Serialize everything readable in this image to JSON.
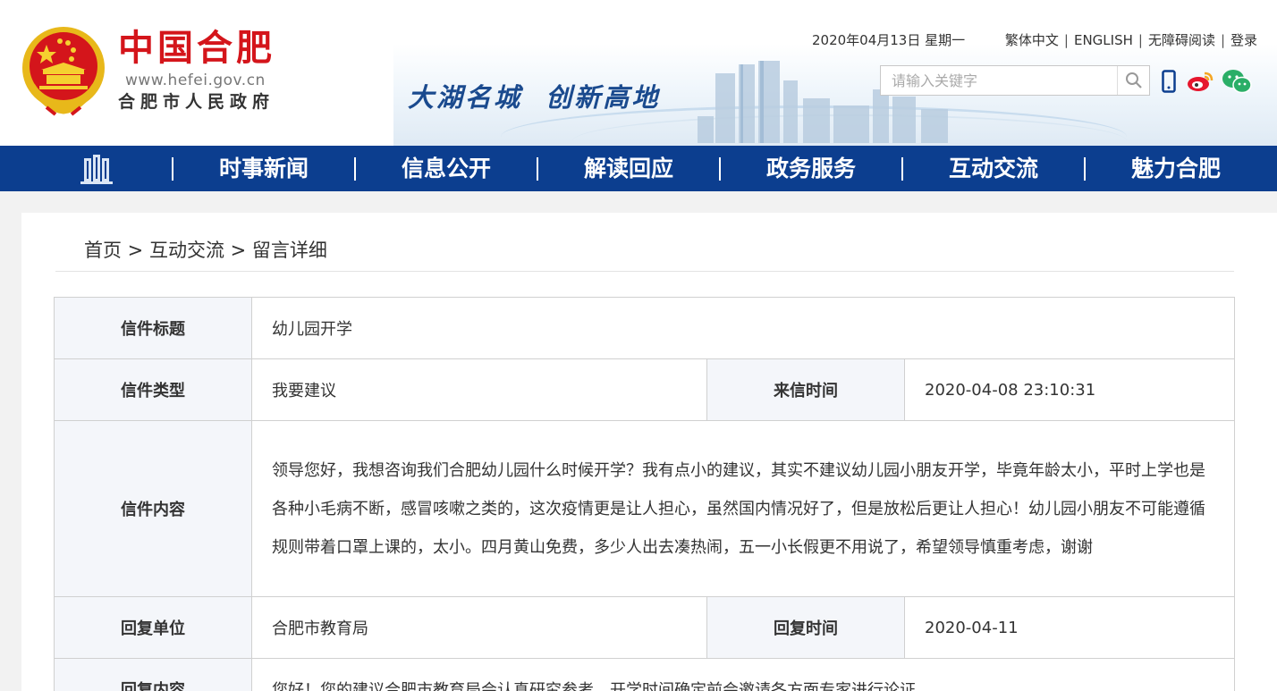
{
  "header": {
    "logo_title": "中国合肥",
    "logo_url": "www.hefei.gov.cn",
    "logo_sub": "合肥市人民政府",
    "slogan": "大湖名城  创新高地",
    "date": "2020年04月13日 星期一",
    "links": [
      "繁体中文",
      "ENGLISH",
      "无障碍阅读",
      "登录"
    ],
    "search_placeholder": "请输入关键字",
    "icons": [
      "mobile-icon",
      "weibo-icon",
      "wechat-icon"
    ]
  },
  "nav": {
    "items": [
      "时事新闻",
      "信息公开",
      "解读回应",
      "政务服务",
      "互动交流",
      "魅力合肥"
    ]
  },
  "breadcrumb": "首页 > 互动交流 > 留言详细",
  "letter": {
    "title_label": "信件标题",
    "title_value": "幼儿园开学",
    "type_label": "信件类型",
    "type_value": "我要建议",
    "time_label": "来信时间",
    "time_value": "2020-04-08 23:10:31",
    "content_label": "信件内容",
    "content_value": "领导您好，我想咨询我们合肥幼儿园什么时候开学？我有点小的建议，其实不建议幼儿园小朋友开学，毕竟年龄太小，平时上学也是各种小毛病不断，感冒咳嗽之类的，这次疫情更是让人担心，虽然国内情况好了，但是放松后更让人担心！幼儿园小朋友不可能遵循规则带着口罩上课的，太小。四月黄山免费，多少人出去凑热闹，五一小长假更不用说了，希望领导慎重考虑，谢谢",
    "reply_unit_label": "回复单位",
    "reply_unit_value": "合肥市教育局",
    "reply_time_label": "回复时间",
    "reply_time_value": "2020-04-11",
    "reply_content_label": "回复内容",
    "reply_content_value": "您好！您的建议合肥市教育局会认真研究参考，开学时间确定前会邀请各方面专家进行论证。"
  },
  "colors": {
    "nav_bg": "#0c3e8f",
    "logo_red": "#d4151b",
    "label_blue": "#1a3d7c",
    "page_bg": "#f2f2f2"
  }
}
